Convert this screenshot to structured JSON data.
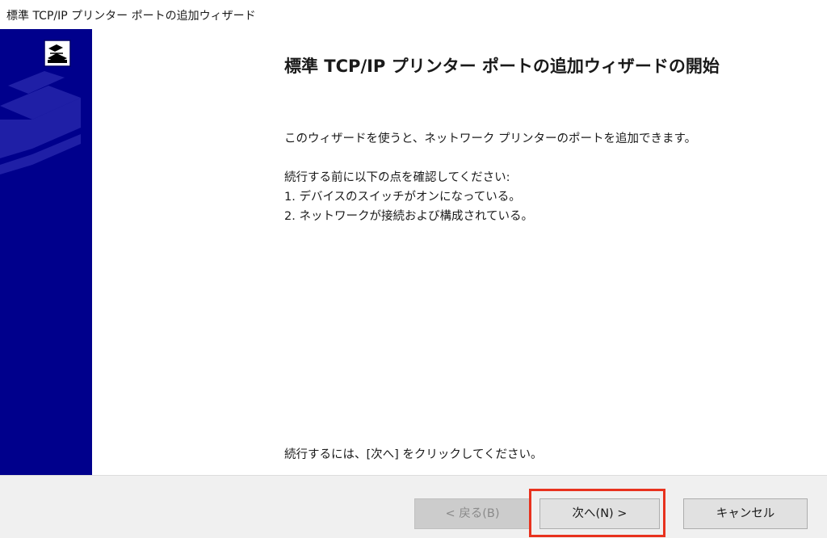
{
  "window": {
    "title": "標準 TCP/IP プリンター ポートの追加ウィザード"
  },
  "main": {
    "heading": "標準 TCP/IP プリンター ポートの追加ウィザードの開始",
    "intro": "このウィザードを使うと、ネットワーク プリンターのポートを追加できます。",
    "checks_header": "続行する前に以下の点を確認してください:",
    "checks": [
      "1. デバイスのスイッチがオンになっている。",
      "2. ネットワークが接続および構成されている。"
    ],
    "footer_note": "続行するには、[次へ] をクリックしてください。"
  },
  "buttons": {
    "back_label": "< 戻る(B)",
    "next_label": "次へ(N) >",
    "cancel_label": "キャンセル"
  },
  "colors": {
    "banner": "#00008c",
    "highlight": "#e8321e",
    "bottom_bar": "#f0f0f0"
  },
  "icons": {
    "banner_icon": "printer-wizard-icon",
    "banner_art": "printer-illustration"
  }
}
